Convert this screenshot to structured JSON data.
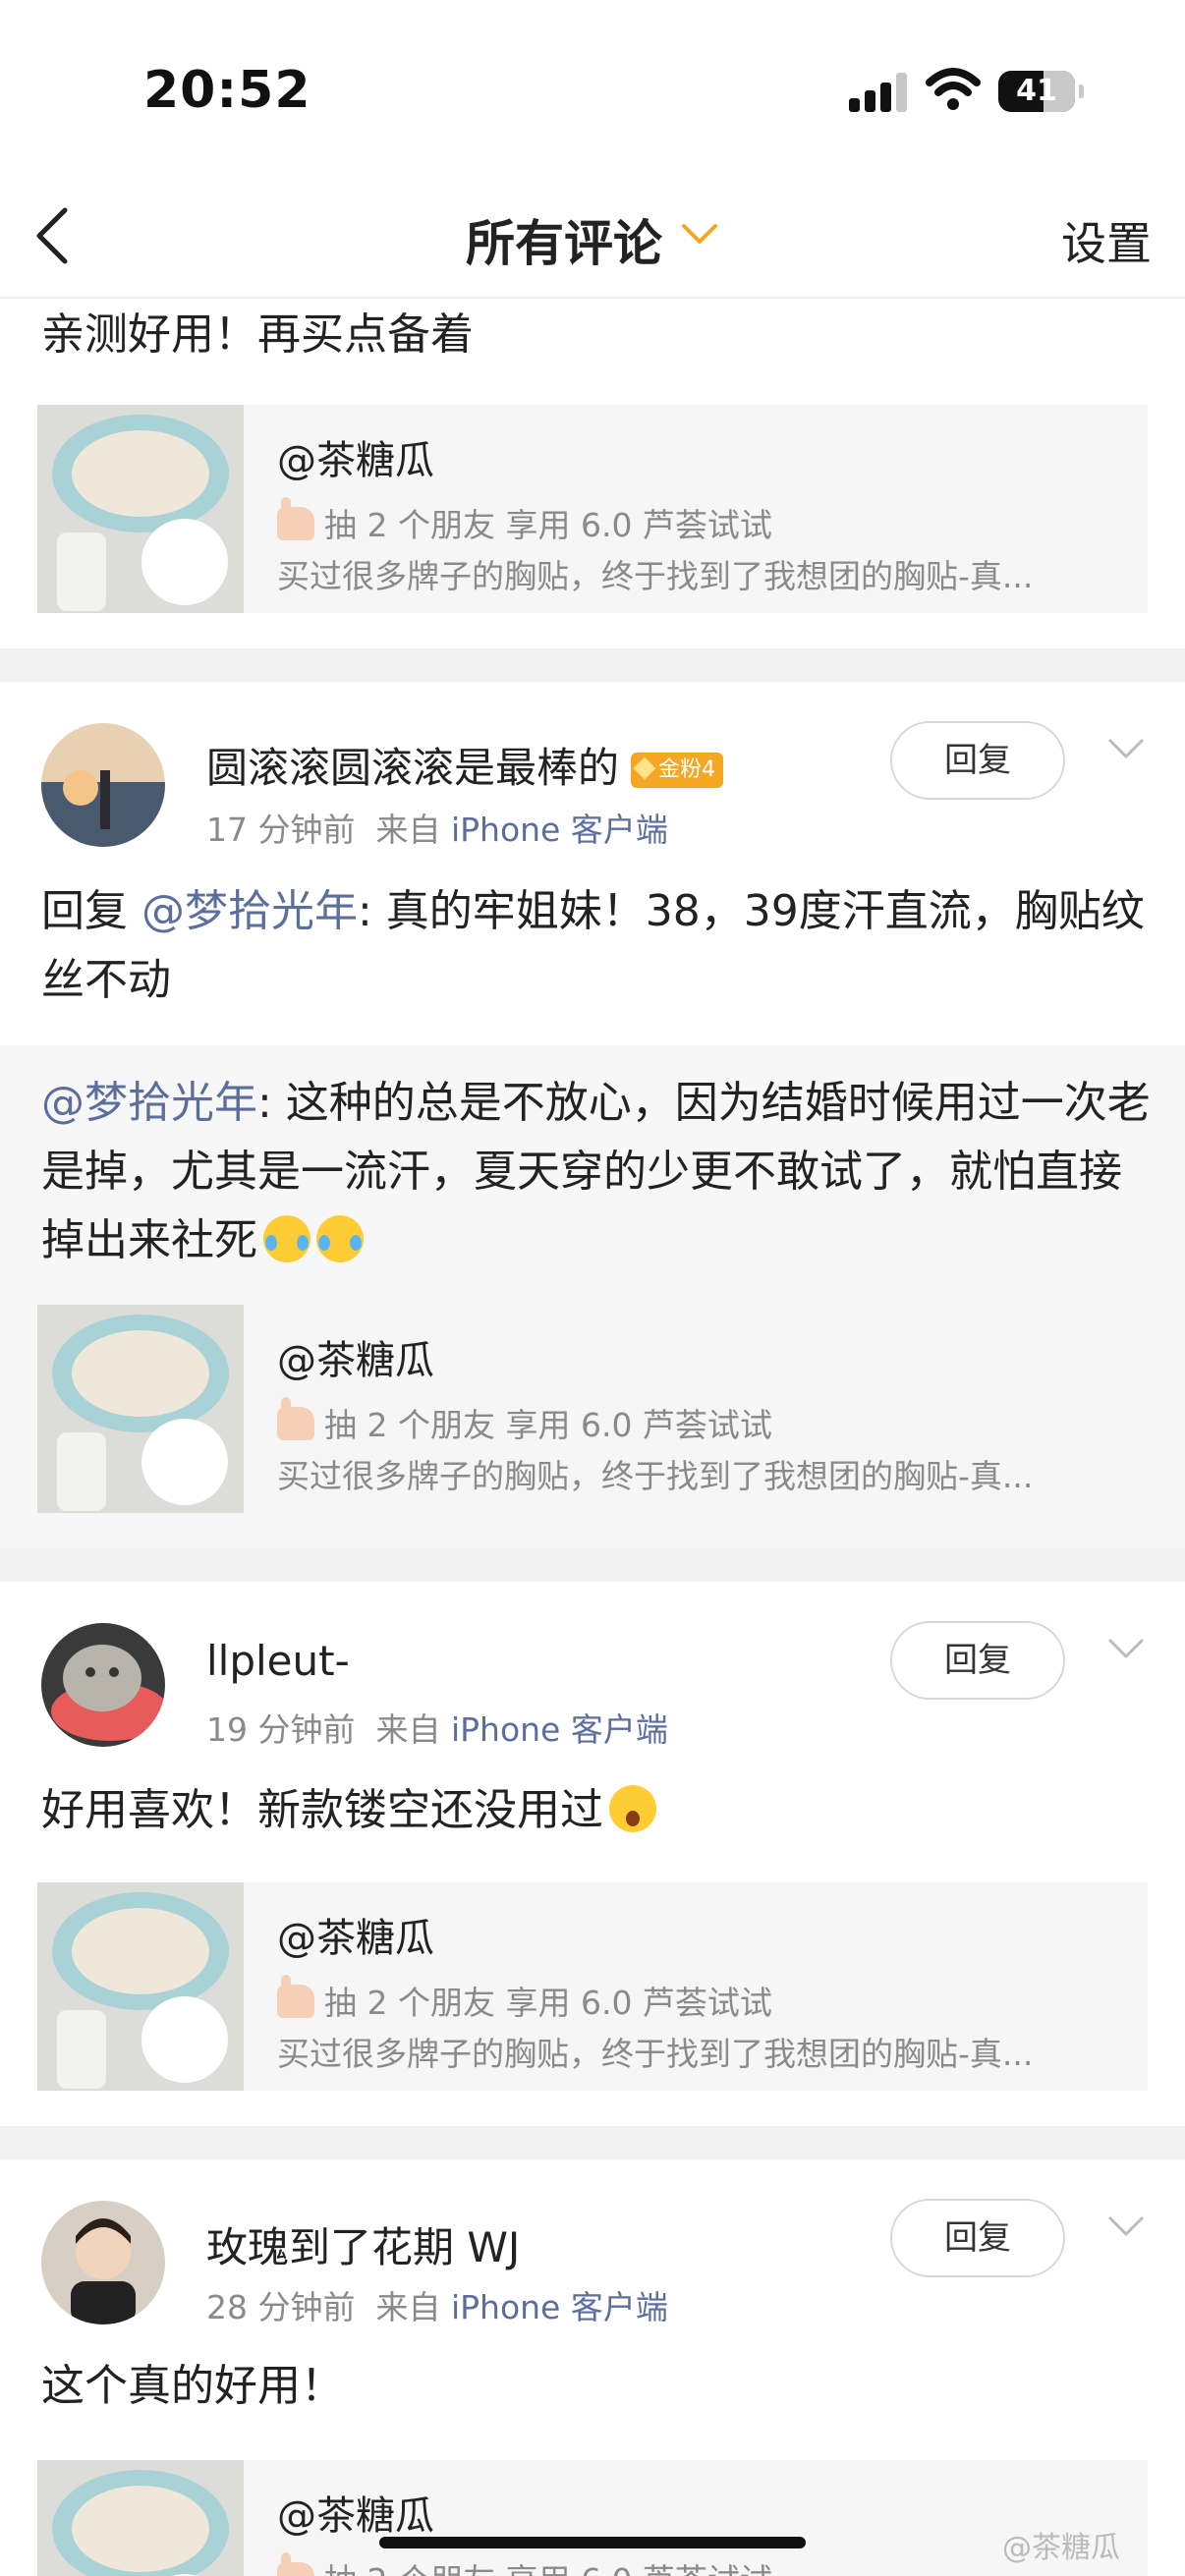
{
  "status_bar": {
    "time": "20:52",
    "battery": "41"
  },
  "nav": {
    "title": "所有评论",
    "settings": "设置"
  },
  "top": {
    "comment_text": "亲测好用！再买点备着"
  },
  "product_card": {
    "title": "@茶糖瓜",
    "line2": "抽 2 个朋友 享用 6.0 芦荟试试",
    "line3": "买过很多牌子的胸贴，终于找到了我想团的胸贴-真..."
  },
  "comments": [
    {
      "username": "圆滚滚圆滚滚是最棒的",
      "badge": "金粉4",
      "time": "17 分钟前",
      "from_label": "来自",
      "source": "iPhone 客户端",
      "reply_label": "回复",
      "text_prefix": "回复 ",
      "mention": "@梦拾光年",
      "text": ": 真的牢姐妹！38，39度汗直流，胸贴纹丝不动",
      "quote_mention": "@梦拾光年",
      "quote_text": ": 这种的总是不放心，因为结婚时候用过一次老是掉，尤其是一流汗，夏天穿的少更不敢试了，就怕直接掉出来社死"
    },
    {
      "username": "llpleut-",
      "time": "19 分钟前",
      "from_label": "来自",
      "source": "iPhone 客户端",
      "reply_label": "回复",
      "text": "好用喜欢！新款镂空还没用过"
    },
    {
      "username": "玫瑰到了花期 WJ",
      "time": "28 分钟前",
      "from_label": "来自",
      "source": "iPhone 客户端",
      "reply_label": "回复",
      "text": "这个真的好用！"
    }
  ],
  "watermark": "@茶糖瓜",
  "colors": {
    "accent": "#f5a623",
    "link": "#5b6e9c",
    "divider": "#f2f2f2"
  }
}
